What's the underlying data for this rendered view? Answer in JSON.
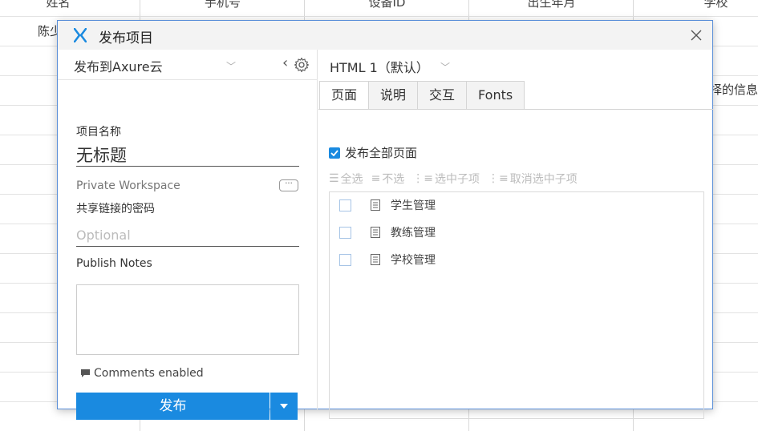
{
  "background": {
    "headers": [
      "姓名",
      "手机号",
      "设备ID",
      "出生年月",
      "学校"
    ],
    "cell_name": "陈少",
    "cell_info": "择的信息"
  },
  "dialog": {
    "title": "发布项目",
    "left": {
      "destination": "发布到Axure云",
      "project_name_label": "项目名称",
      "project_name_value": "无标题",
      "workspace": "Private Workspace",
      "workspace_more": "···",
      "password_label": "共享链接的密码",
      "password_placeholder": "Optional",
      "notes_label": "Publish Notes",
      "comments": "Comments enabled",
      "publish_button": "发布"
    },
    "right": {
      "html_selector": "HTML 1（默认）",
      "tabs": [
        "页面",
        "说明",
        "交互",
        "Fonts"
      ],
      "publish_all_label": "发布全部页面",
      "publish_all_checked": true,
      "toolbar": {
        "select_all": "全选",
        "select_none": "不选",
        "select_children": "选中子项",
        "deselect_children": "取消选中子项"
      },
      "pages": [
        "学生管理",
        "教练管理",
        "学校管理"
      ]
    }
  },
  "colors": {
    "accent": "#1a8ae0",
    "dialog_border": "#5a8fd8",
    "logo": "#1a8ae0"
  }
}
